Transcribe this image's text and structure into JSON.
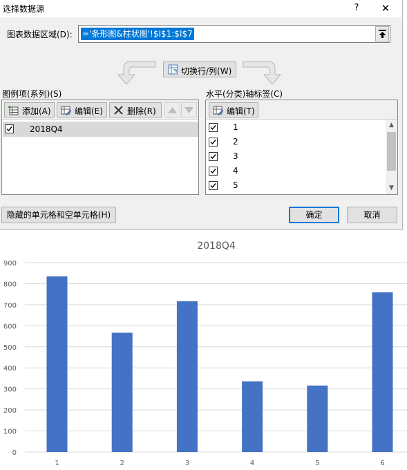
{
  "dialog": {
    "title": "选择数据源",
    "help_label": "?",
    "close_label": "✕",
    "range_label": "图表数据区域(D):",
    "range_value": "='条形图&柱状图'!$I$1:$I$7",
    "switch_label": "切换行/列(W)",
    "legend_section_label": "图例项(系列)(S)",
    "axis_section_label": "水平(分类)轴标签(C)",
    "legend_toolbar": {
      "add_label": "添加(A)",
      "edit_label": "编辑(E)",
      "delete_label": "删除(R)"
    },
    "axis_toolbar": {
      "edit_label": "编辑(T)"
    },
    "series": [
      {
        "name": "2018Q4",
        "checked": true
      }
    ],
    "categories": [
      {
        "label": "1",
        "checked": true
      },
      {
        "label": "2",
        "checked": true
      },
      {
        "label": "3",
        "checked": true
      },
      {
        "label": "4",
        "checked": true
      },
      {
        "label": "5",
        "checked": true
      }
    ],
    "hidden_cells_label": "隐藏的单元格和空单元格(H)",
    "ok_label": "确定",
    "cancel_label": "取消"
  },
  "colors": {
    "bar": "#4472c4",
    "gridline": "#d9d9d9",
    "axis_text": "#595959",
    "title_text": "#595959",
    "selection": "#0078d7"
  },
  "chart_data": {
    "type": "bar",
    "title": "2018Q4",
    "categories": [
      "1",
      "2",
      "3",
      "4",
      "5",
      "6"
    ],
    "series": [
      {
        "name": "2018Q4",
        "values": [
          835,
          567,
          717,
          336,
          316,
          759
        ]
      }
    ],
    "ylim": [
      0,
      900
    ],
    "yticks": [
      0,
      100,
      200,
      300,
      400,
      500,
      600,
      700,
      800,
      900
    ],
    "grid": true,
    "legend": "none"
  }
}
